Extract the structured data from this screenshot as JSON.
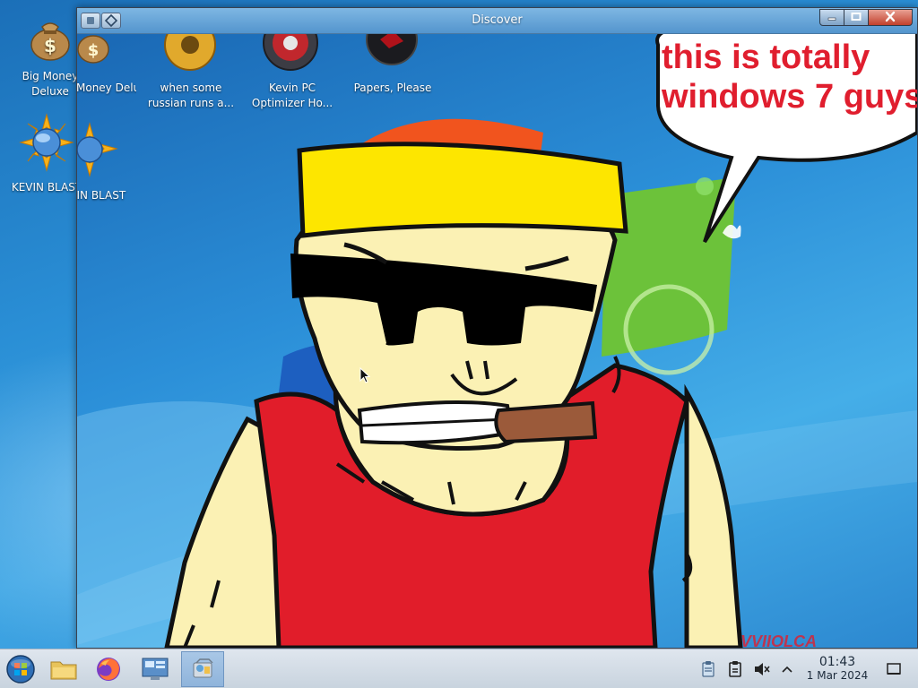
{
  "desktop": {
    "icons": [
      {
        "label": "Big Money Deluxe"
      },
      {
        "label": "KEVIN BLAST"
      }
    ]
  },
  "window": {
    "title": "Discover",
    "inner_icons": [
      {
        "label": "Big Money Deluxe"
      },
      {
        "label": "when some russian runs a..."
      },
      {
        "label": "Kevin PC Optimizer Ho..."
      },
      {
        "label": "Papers, Please"
      },
      {
        "label": "KEVIN BLAST"
      }
    ],
    "speech_bubble": {
      "line1": "this is totally",
      "line2": "windows 7 guys"
    },
    "watermark": "VVIIOLCA"
  },
  "taskbar": {
    "apps": [
      {
        "icon": "start-orb-icon"
      },
      {
        "icon": "folder-icon"
      },
      {
        "icon": "firefox-icon"
      },
      {
        "icon": "control-panel-icon"
      },
      {
        "icon": "discover-icon",
        "active": true
      }
    ],
    "tray": [
      {
        "icon": "clipboard-icon"
      },
      {
        "icon": "notes-icon"
      },
      {
        "icon": "volume-muted-icon"
      },
      {
        "icon": "chevron-up-icon"
      }
    ],
    "clock": {
      "time": "01:43",
      "date": "1 Mar 2024"
    }
  },
  "colors": {
    "desktop_blue": "#2a8fd6",
    "shirt_red": "#e11d2a",
    "hat_yellow": "#fde600",
    "skin": "#fbf1b4",
    "bubble_text_red": "#e01e2e"
  }
}
